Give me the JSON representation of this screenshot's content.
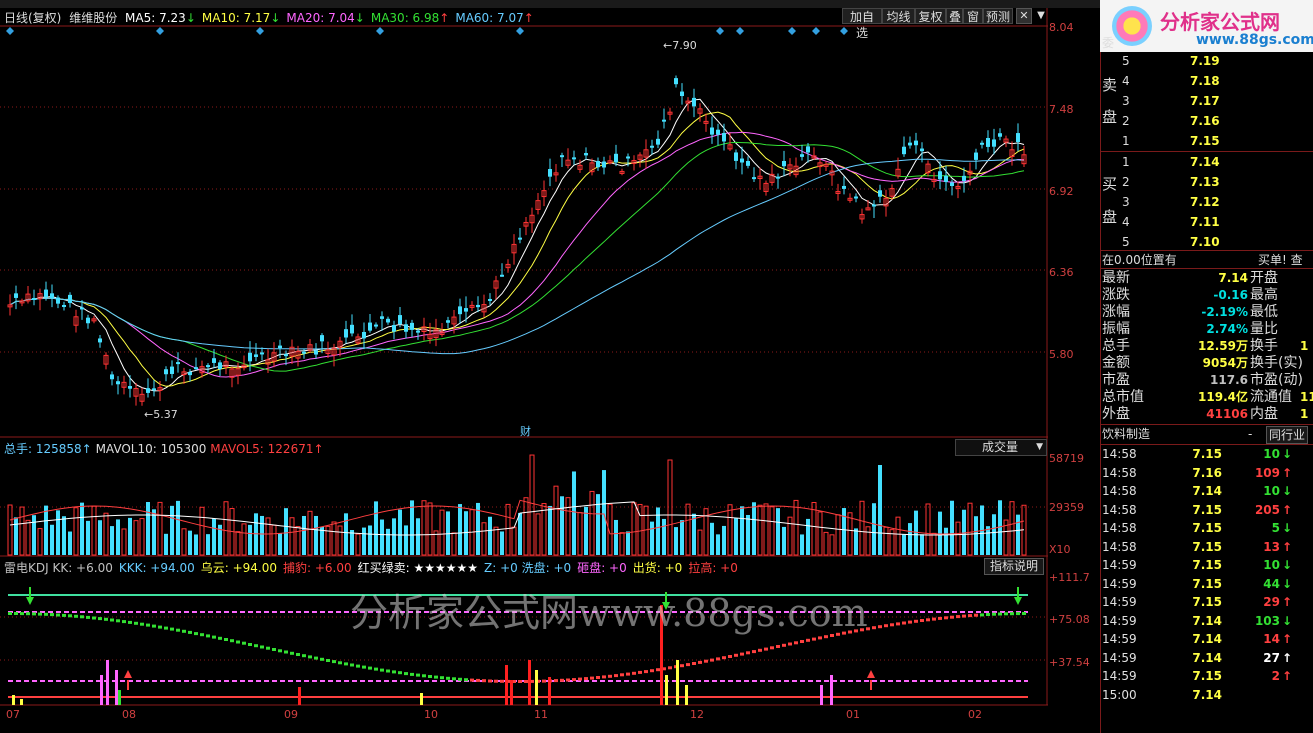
{
  "header": {
    "period": "日线(复权)",
    "stock": "维维股份",
    "ma": [
      {
        "label": "MA5: 7.23",
        "arrow": "↓",
        "color": "#ffffff"
      },
      {
        "label": "MA10: 7.17",
        "arrow": "↓",
        "color": "#ffff44"
      },
      {
        "label": "MA20: 7.04",
        "arrow": "↓",
        "color": "#ff66ff"
      },
      {
        "label": "MA30: 6.98",
        "arrow": "↑",
        "color": "#33e033"
      },
      {
        "label": "MA60: 7.07",
        "arrow": "↑",
        "color": "#66ccff"
      }
    ],
    "buttons": [
      "加自选",
      "均线",
      "复权",
      "叠",
      "窗",
      "预测"
    ]
  },
  "price_axis": [
    "8.04",
    "7.48",
    "6.92",
    "6.36",
    "5.80"
  ],
  "price_annotations": {
    "high": "7.90",
    "low": "5.37",
    "fin": "财"
  },
  "volume": {
    "label_total": "总手: 125858",
    "label_mavol10": "MAVOL10: 105300",
    "label_mavol5": "MAVOL5: 122671",
    "dropdown": "成交量",
    "axis": [
      "58719",
      "29359",
      "X10"
    ]
  },
  "indicator": {
    "parts": [
      {
        "t": "雷电KDJ KK: +6.00",
        "c": "#c0c0c0"
      },
      {
        "t": "KKK: +94.00",
        "c": "#66ccff"
      },
      {
        "t": "乌云: +94.00",
        "c": "#ffff44"
      },
      {
        "t": "捕豹: +6.00",
        "c": "#ff4040"
      },
      {
        "t": "红买绿卖: ★★★★★★",
        "c": "#ffffff"
      },
      {
        "t": "Z: +0 洗盘: +0",
        "c": "#66ccff"
      },
      {
        "t": "砸盘: +0",
        "c": "#ff66ff"
      },
      {
        "t": "出货: +0",
        "c": "#ffff44"
      },
      {
        "t": "拉高: +0",
        "c": "#ff4040"
      }
    ],
    "help": "指标说明",
    "axis": [
      "+111.7",
      "+75.08",
      "+37.54"
    ]
  },
  "dates": [
    "07",
    "08",
    "09",
    "10",
    "11",
    "12",
    "01",
    "02"
  ],
  "watermark": "分析家公式网www.88gs.com",
  "logo": {
    "cn": "分析家公式网",
    "url": "www.88gs.com"
  },
  "orderbook": {
    "sell_label": [
      "卖",
      "盘"
    ],
    "buy_label": [
      "买",
      "盘"
    ],
    "top_partial": "委",
    "sell": [
      {
        "n": "5",
        "p": "7.19"
      },
      {
        "n": "4",
        "p": "7.18"
      },
      {
        "n": "3",
        "p": "7.17"
      },
      {
        "n": "2",
        "p": "7.16"
      },
      {
        "n": "1",
        "p": "7.15"
      }
    ],
    "buy": [
      {
        "n": "1",
        "p": "7.14"
      },
      {
        "n": "2",
        "p": "7.13"
      },
      {
        "n": "3",
        "p": "7.12"
      },
      {
        "n": "4",
        "p": "7.11"
      },
      {
        "n": "5",
        "p": "7.10"
      }
    ]
  },
  "position": {
    "left": "在0.00位置有",
    "right": "买单! 查"
  },
  "stats": [
    {
      "k": "最新",
      "v": "7.14",
      "k2": "开盘",
      "vc": "#ffff44"
    },
    {
      "k": "涨跌",
      "v": "-0.16",
      "k2": "最高",
      "vc": "#00e0e0"
    },
    {
      "k": "涨幅",
      "v": "-2.19%",
      "k2": "最低",
      "vc": "#00e0e0"
    },
    {
      "k": "振幅",
      "v": "2.74%",
      "k2": "量比",
      "vc": "#00e0e0"
    },
    {
      "k": "总手",
      "v": "12.59万",
      "k2": "换手",
      "vc": "#ffff44"
    },
    {
      "k": "金额",
      "v": "9054万",
      "k2": "换手(实)",
      "vc": "#ffff44"
    },
    {
      "k": "市盈",
      "v": "117.6",
      "k2": "市盈(动)",
      "vc": "#c0c0c0"
    },
    {
      "k": "总市值",
      "v": "119.4亿",
      "k2": "流通值",
      "vc": "#ffff44"
    },
    {
      "k": "外盘",
      "v": "41106",
      "k2": "内盘",
      "vc": "#ff4040"
    }
  ],
  "stats_partial": [
    "1",
    "11",
    "1"
  ],
  "industry": {
    "name": "饮料制造",
    "btn": "同行业"
  },
  "ticks": [
    {
      "t": "14:58",
      "p": "7.15",
      "v": "10",
      "d": "down"
    },
    {
      "t": "14:58",
      "p": "7.16",
      "v": "109",
      "d": "up"
    },
    {
      "t": "14:58",
      "p": "7.14",
      "v": "10",
      "d": "down"
    },
    {
      "t": "14:58",
      "p": "7.15",
      "v": "205",
      "d": "up"
    },
    {
      "t": "14:58",
      "p": "7.15",
      "v": "5",
      "d": "down"
    },
    {
      "t": "14:58",
      "p": "7.15",
      "v": "13",
      "d": "up"
    },
    {
      "t": "14:59",
      "p": "7.15",
      "v": "10",
      "d": "down"
    },
    {
      "t": "14:59",
      "p": "7.15",
      "v": "44",
      "d": "down"
    },
    {
      "t": "14:59",
      "p": "7.15",
      "v": "29",
      "d": "up"
    },
    {
      "t": "14:59",
      "p": "7.14",
      "v": "103",
      "d": "down"
    },
    {
      "t": "14:59",
      "p": "7.14",
      "v": "14",
      "d": "up"
    },
    {
      "t": "14:59",
      "p": "7.14",
      "v": "27",
      "d": "upw"
    },
    {
      "t": "14:59",
      "p": "7.15",
      "v": "2",
      "d": "up"
    },
    {
      "t": "15:00",
      "p": "7.14",
      "v": "",
      "d": ""
    }
  ],
  "colors": {
    "up": "#ff3333",
    "down": "#44e0ff",
    "grid": "#8b1a1a"
  }
}
